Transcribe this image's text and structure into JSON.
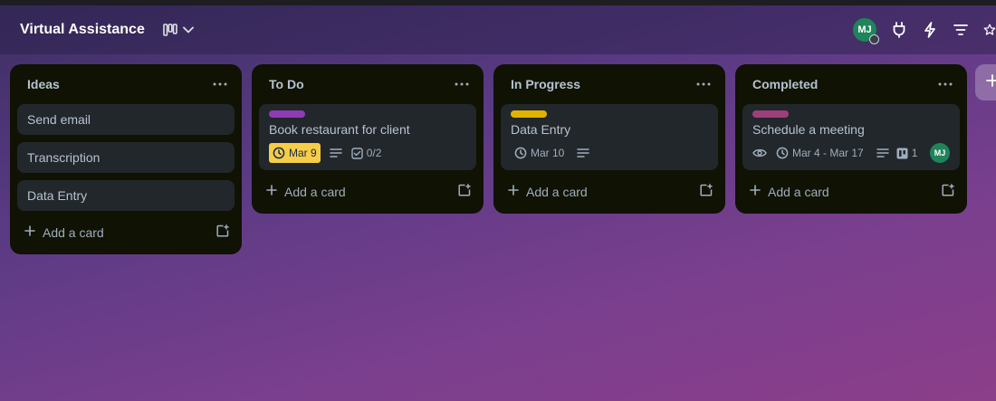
{
  "board": {
    "title": "Virtual Assistance"
  },
  "header": {
    "member_initials": "MJ"
  },
  "colors": {
    "label_purple": "#8f3bb5",
    "label_yellow": "#e2b203",
    "label_magenta": "#9e3f7b",
    "due_warning": "#f5cd47",
    "avatar_green": "#1f845a"
  },
  "lists": [
    {
      "title": "Ideas",
      "cards": [
        {
          "title": "Send email"
        },
        {
          "title": "Transcription"
        },
        {
          "title": "Data Entry"
        }
      ],
      "add_label": "Add a card"
    },
    {
      "title": "To Do",
      "cards": [
        {
          "title": "Book restaurant for client",
          "label_color": "#8f3bb5",
          "due": "Mar 9",
          "checklist": "0/2"
        }
      ],
      "add_label": "Add a card"
    },
    {
      "title": "In Progress",
      "cards": [
        {
          "title": "Data Entry",
          "label_color": "#e2b203",
          "due": "Mar 10"
        }
      ],
      "add_label": "Add a card"
    },
    {
      "title": "Completed",
      "cards": [
        {
          "title": "Schedule a meeting",
          "label_color": "#9e3f7b",
          "due": "Mar 4 - Mar 17",
          "attachments": "1",
          "member": "MJ"
        }
      ],
      "add_label": "Add a card"
    }
  ]
}
